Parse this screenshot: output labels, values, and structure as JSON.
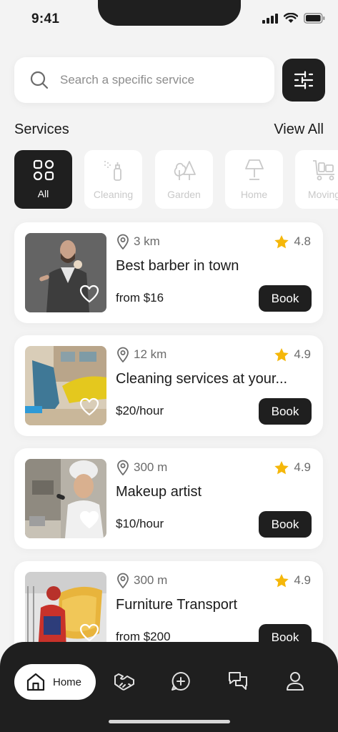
{
  "status_bar": {
    "time": "9:41"
  },
  "search": {
    "placeholder": "Search a specific service"
  },
  "services_section": {
    "title": "Services",
    "view_all": "View All"
  },
  "categories": [
    {
      "label": "All",
      "icon": "grid-icon",
      "active": true
    },
    {
      "label": "Cleaning",
      "icon": "spray-bottle-icon",
      "active": false
    },
    {
      "label": "Garden",
      "icon": "trees-icon",
      "active": false
    },
    {
      "label": "Home",
      "icon": "lamp-icon",
      "active": false
    },
    {
      "label": "Moving",
      "icon": "cart-icon",
      "active": false
    }
  ],
  "listings": [
    {
      "distance": "3 km",
      "rating": "4.8",
      "title": "Best barber in town",
      "price": "from $16",
      "book": "Book"
    },
    {
      "distance": "12 km",
      "rating": "4.9",
      "title": "Cleaning services at your...",
      "price": "$20/hour",
      "book": "Book"
    },
    {
      "distance": "300 m",
      "rating": "4.9",
      "title": "Makeup artist",
      "price": "$10/hour",
      "book": "Book"
    },
    {
      "distance": "300 m",
      "rating": "4.9",
      "title": "Furniture Transport",
      "price": "from $200",
      "book": "Book"
    }
  ],
  "bottom_nav": {
    "home_label": "Home",
    "items": [
      "home-icon",
      "handshake-icon",
      "chat-plus-icon",
      "messages-icon",
      "profile-icon"
    ]
  },
  "colors": {
    "dark": "#1f1f1f",
    "star": "#f5b70a",
    "background": "#f3f3f3"
  }
}
